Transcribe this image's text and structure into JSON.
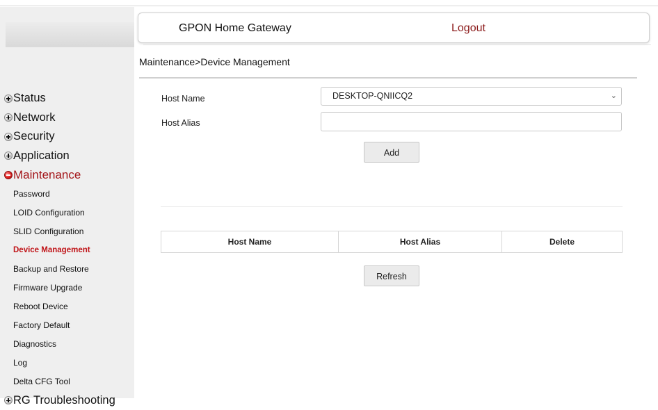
{
  "header": {
    "title": "GPON Home Gateway",
    "logout": "Logout"
  },
  "breadcrumb": "Maintenance>Device Management",
  "sidebar": {
    "top_items": [
      {
        "label": "Status",
        "expanded": false
      },
      {
        "label": "Network",
        "expanded": false
      },
      {
        "label": "Security",
        "expanded": false
      },
      {
        "label": "Application",
        "expanded": false
      },
      {
        "label": "Maintenance",
        "expanded": true
      }
    ],
    "maintenance_items": [
      "Password",
      "LOID Configuration",
      "SLID Configuration",
      "Device Management",
      "Backup and Restore",
      "Firmware Upgrade",
      "Reboot Device",
      "Factory Default",
      "Diagnostics",
      "Log",
      "Delta CFG Tool"
    ],
    "active_item": "Device Management",
    "last_item": {
      "label": "RG Troubleshooting",
      "expanded": false
    }
  },
  "form": {
    "host_name_label": "Host Name",
    "host_name_value": "DESKTOP-QNIICQ2",
    "host_alias_label": "Host Alias",
    "host_alias_value": "",
    "add_button": "Add"
  },
  "table": {
    "columns": [
      "Host Name",
      "Host Alias",
      "Delete"
    ],
    "rows": []
  },
  "refresh_button": "Refresh",
  "colors": {
    "accent": "#a4161a",
    "logout": "#8b1a1a",
    "sidebar_bg": "#efefef"
  }
}
